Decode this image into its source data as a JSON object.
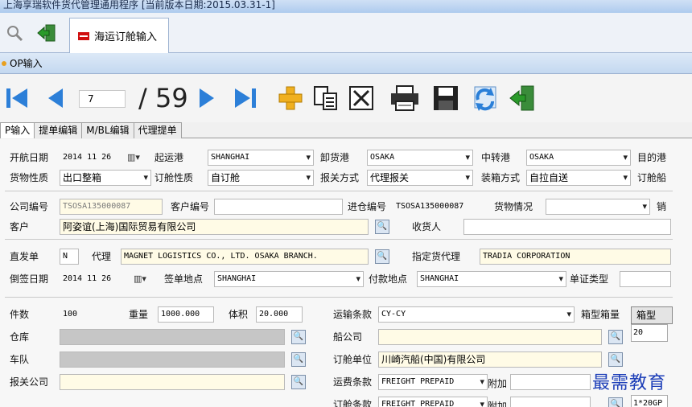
{
  "title": "上海享瑞软件货代管理通用程序    [当前版本日期:2015.03.31-1]",
  "doc_tab": "海运订舱输入",
  "section": "OP输入",
  "nav": {
    "current_page": "7",
    "total": "/ 59"
  },
  "subtabs": [
    "P输入",
    "提单编辑",
    "M/BL编辑",
    "代理提单"
  ],
  "labels": {
    "sail_date": "开航日期",
    "pol": "起运港",
    "pod": "卸货港",
    "transit": "中转港",
    "dest": "目的港",
    "cargo_type": "货物性质",
    "booking_type": "订舱性质",
    "customs_mode": "报关方式",
    "packing_mode": "装箱方式",
    "booking_ship": "订舱船",
    "company_no": "公司编号",
    "customer_no": "客户编号",
    "warehouse_no": "进仓编号",
    "cargo_status": "货物情况",
    "sales": "销",
    "customer": "客户",
    "consignee": "收货人",
    "direct": "直发单",
    "agent": "代理",
    "designated_agent": "指定货代理",
    "backdate": "倒签日期",
    "sign_place": "签单地点",
    "pay_place": "付款地点",
    "cert_type": "单证类型",
    "pieces": "件数",
    "weight": "重量",
    "volume": "体积",
    "transport_terms": "运输条款",
    "container_vol": "箱型箱量",
    "warehouse": "仓库",
    "carrier": "船公司",
    "fleet": "车队",
    "booking_unit": "订舱单位",
    "customs_company": "报关公司",
    "freight_terms": "运费条款",
    "extra": "附加",
    "booking_terms": "订舱条款"
  },
  "values": {
    "sail_date": "2014 11 26",
    "pol": "SHANGHAI",
    "pod": "OSAKA",
    "transit": "OSAKA",
    "cargo_type": "出口整箱",
    "booking_type": "自订舱",
    "customs_mode": "代理报关",
    "packing_mode": "自拉自送",
    "company_no": "TSOSA135000087",
    "warehouse_no": "TSOSA135000087",
    "customer": "阿姿谊(上海)国际贸易有限公司",
    "direct": "N",
    "agent": "MAGNET LOGISTICS CO., LTD. OSAKA BRANCH.",
    "designated_agent": "TRADIA CORPORATION",
    "backdate": "2014 11 26",
    "sign_place": "SHANGHAI",
    "pay_place": "SHANGHAI",
    "pieces": "100",
    "weight": "1000.000",
    "volume": "20.000",
    "transport_terms": "CY-CY",
    "booking_unit": "川崎汽船(中国)有限公司",
    "freight_terms": "FREIGHT PREPAID",
    "booking_terms": "FREIGHT PREPAID"
  },
  "grid": {
    "header": "箱型",
    "rows": [
      "20",
      "1*20GP"
    ]
  },
  "watermark": "最需教育"
}
